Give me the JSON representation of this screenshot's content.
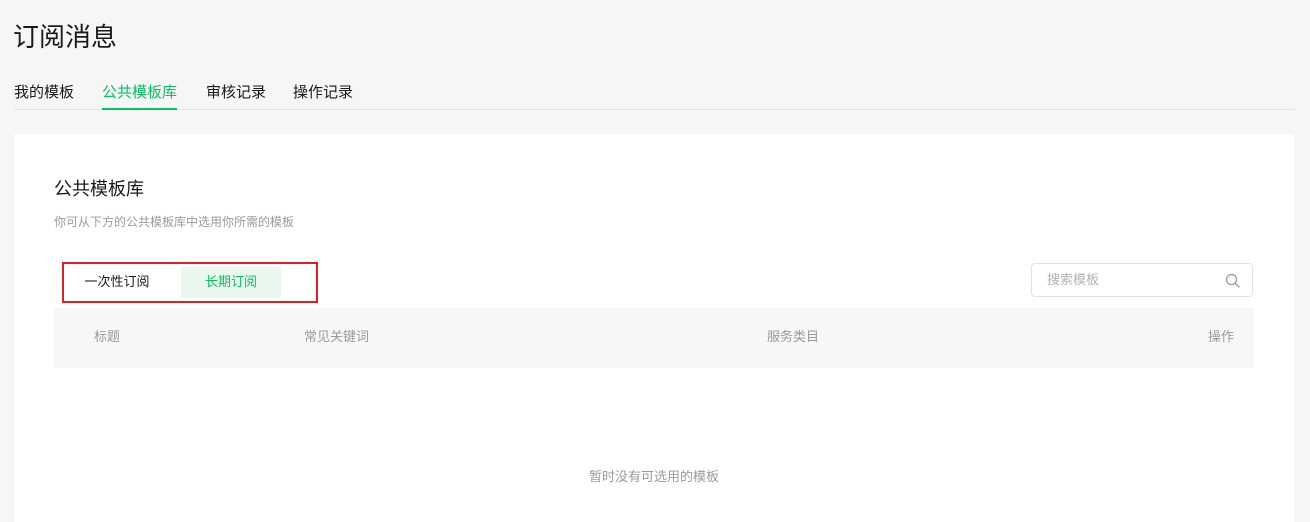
{
  "page": {
    "title": "订阅消息"
  },
  "tabs": [
    {
      "label": "我的模板",
      "active": false
    },
    {
      "label": "公共模板库",
      "active": true
    },
    {
      "label": "审核记录",
      "active": false
    },
    {
      "label": "操作记录",
      "active": false
    }
  ],
  "card": {
    "title": "公共模板库",
    "description": "你可从下方的公共模板库中选用你所需的模板",
    "segments": [
      {
        "label": "一次性订阅",
        "selected": false
      },
      {
        "label": "长期订阅",
        "selected": true
      }
    ],
    "search": {
      "placeholder": "搜索模板",
      "value": "",
      "icon": "search-icon"
    },
    "table": {
      "columns": [
        "标题",
        "常见关键词",
        "服务类目",
        "操作"
      ]
    },
    "empty_text": "暂时没有可选用的模板"
  },
  "colors": {
    "accent": "#07c160",
    "highlight_border": "#e02020",
    "selected_segment_bg": "#eaf7ee"
  }
}
